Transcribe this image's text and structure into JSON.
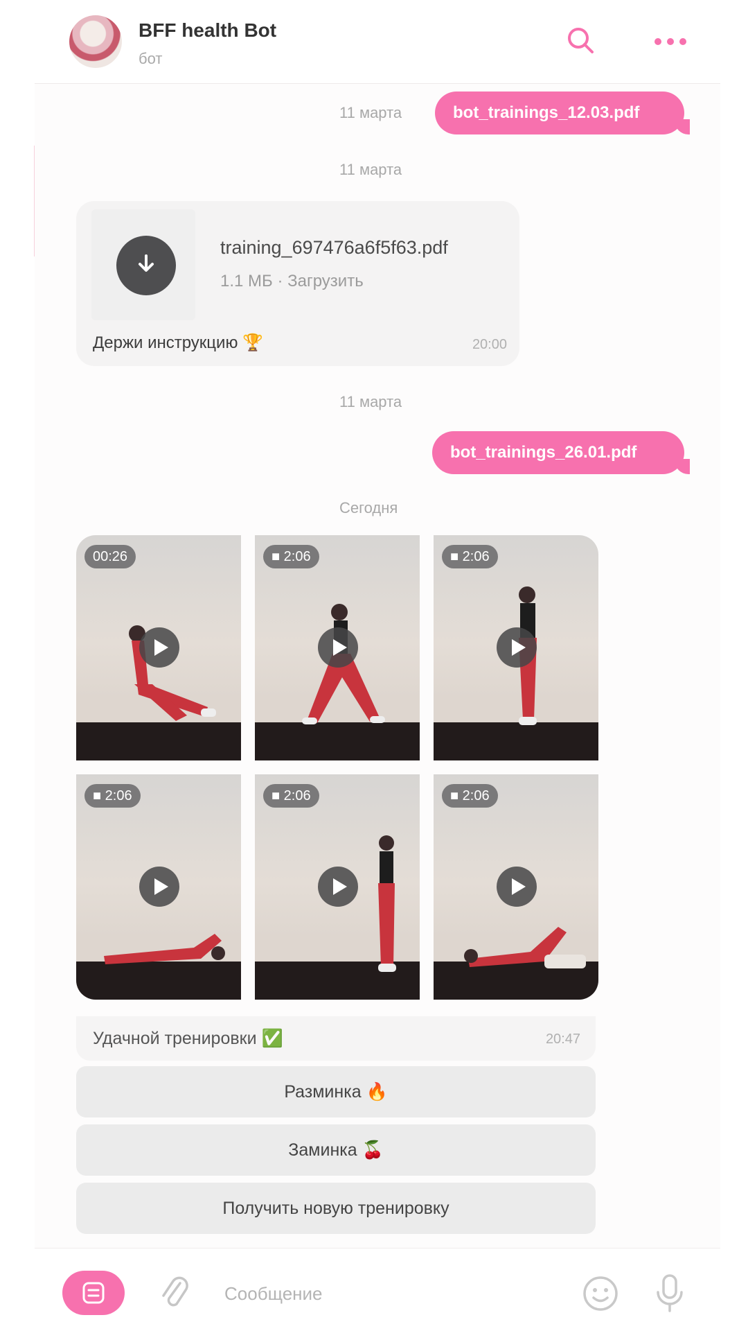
{
  "header": {
    "title": "BFF health Bot",
    "subtitle": "бот",
    "icons": [
      "search-icon",
      "more-icon"
    ]
  },
  "colors": {
    "accent": "#f771ae",
    "bubble_in": "#f4f3f3",
    "keyboard_button": "#ebebeb"
  },
  "messages": {
    "ts1": "11 марта",
    "out1": "bot_trainings_12.03.pdf",
    "ts2": "11 марта",
    "file": {
      "name": "training_697476a6f5f63.pdf",
      "size": "1.1 МБ",
      "sep": "·",
      "action": "Загрузить",
      "caption": "Держи инструкцию 🏆",
      "time": "20:00"
    },
    "ts3": "11 марта",
    "out2": "bot_trainings_26.01.pdf",
    "ts4": "Сегодня"
  },
  "videos": [
    {
      "duration": "00:26"
    },
    {
      "duration": "2:06"
    },
    {
      "duration": "2:06"
    },
    {
      "duration": "2:06"
    },
    {
      "duration": "2:06"
    },
    {
      "duration": "2:06"
    }
  ],
  "album": {
    "caption": "Удачной тренировки ✅",
    "time": "20:47"
  },
  "keyboard": [
    {
      "label": "Разминка 🔥"
    },
    {
      "label": "Заминка 🍒"
    },
    {
      "label": "Получить новую тренировку"
    }
  ],
  "composer": {
    "placeholder": "Сообщение"
  }
}
